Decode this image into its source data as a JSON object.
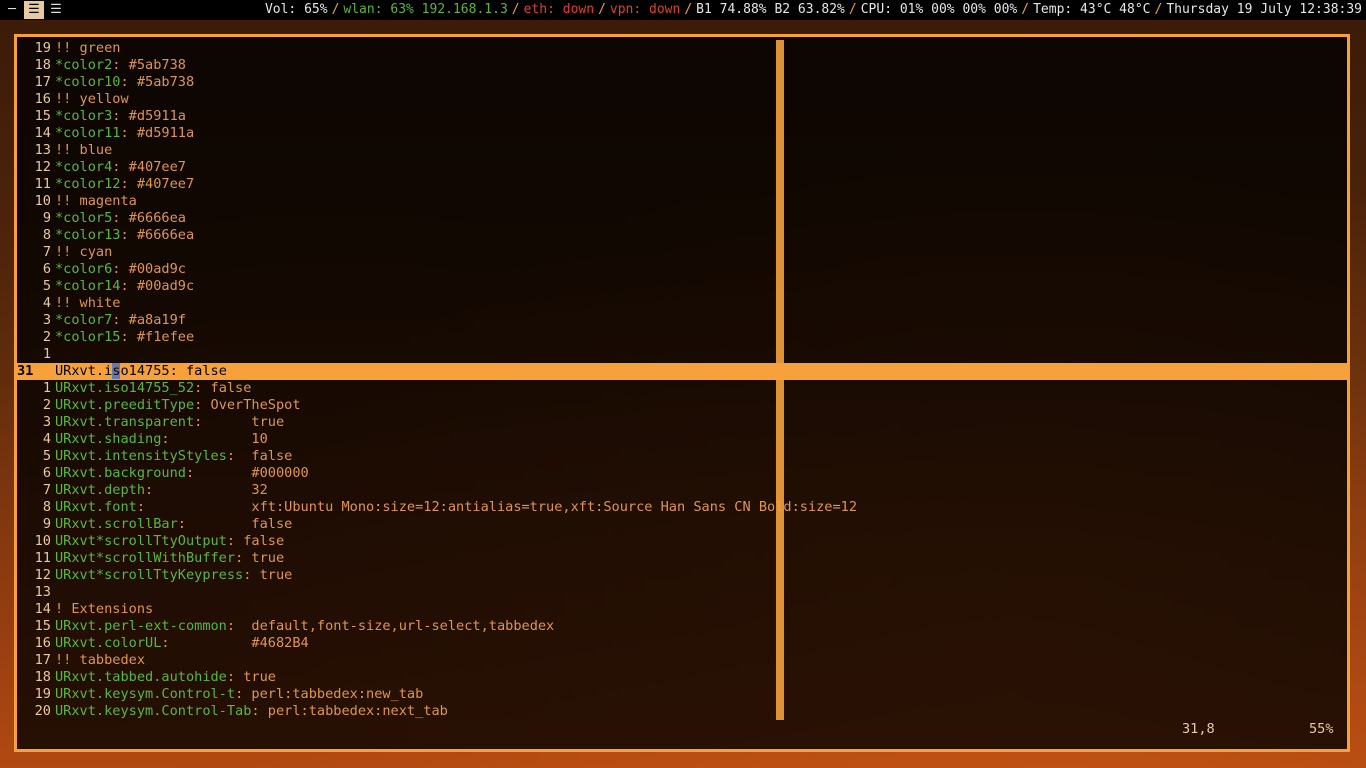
{
  "topbar": {
    "workspace_icons": [
      "minimize-glyph",
      "menu-glyph",
      "menu-glyph"
    ],
    "vol": "Vol: 65%",
    "wlan": "wlan: 63% 192.168.1.3",
    "eth": "eth: down",
    "vpn": "vpn: down",
    "battery": "B1 74.88%  B2 63.82%",
    "cpu": "CPU: 01% 00% 00% 00%",
    "temp": "Temp: 43°C 48°C",
    "datetime": "Thursday 19 July 12:38:39"
  },
  "colors": {
    "accent": "#f6a13c",
    "green": "#5ab738",
    "red": "#e0412a"
  },
  "editor": {
    "lines": [
      {
        "n": "19",
        "key": "",
        "rest": "!! green"
      },
      {
        "n": "18",
        "key": "*color2",
        "rest": ": #5ab738"
      },
      {
        "n": "17",
        "key": "*color10",
        "rest": ": #5ab738"
      },
      {
        "n": "16",
        "key": "",
        "rest": "!! yellow"
      },
      {
        "n": "15",
        "key": "*color3",
        "rest": ": #d5911a"
      },
      {
        "n": "14",
        "key": "*color11",
        "rest": ": #d5911a"
      },
      {
        "n": "13",
        "key": "",
        "rest": "!! blue"
      },
      {
        "n": "12",
        "key": "*color4",
        "rest": ": #407ee7"
      },
      {
        "n": "11",
        "key": "*color12",
        "rest": ": #407ee7"
      },
      {
        "n": "10",
        "key": "",
        "rest": "!! magenta"
      },
      {
        "n": "9",
        "key": "*color5",
        "rest": ": #6666ea"
      },
      {
        "n": "8",
        "key": "*color13",
        "rest": ": #6666ea"
      },
      {
        "n": "7",
        "key": "",
        "rest": "!! cyan"
      },
      {
        "n": "6",
        "key": "*color6",
        "rest": ": #00ad9c"
      },
      {
        "n": "5",
        "key": "*color14",
        "rest": ": #00ad9c"
      },
      {
        "n": "4",
        "key": "",
        "rest": "!! white"
      },
      {
        "n": "3",
        "key": "*color7",
        "rest": ": #a8a19f"
      },
      {
        "n": "2",
        "key": "*color15",
        "rest": ": #f1efee"
      },
      {
        "n": "1",
        "key": "",
        "rest": ""
      },
      {
        "n": "31",
        "key": "",
        "rest": "URxvt.iso14755: false",
        "current": true
      },
      {
        "n": "1",
        "key": "URxvt.iso14755_52",
        "rest": ": false"
      },
      {
        "n": "2",
        "key": "URxvt.preeditType",
        "rest": ": OverTheSpot"
      },
      {
        "n": "3",
        "key": "URxvt.transparent",
        "rest": ":      true"
      },
      {
        "n": "4",
        "key": "URxvt.shading",
        "rest": ":          10"
      },
      {
        "n": "5",
        "key": "URxvt.intensityStyles",
        "rest": ":  false"
      },
      {
        "n": "6",
        "key": "URxvt.background",
        "rest": ":       #000000"
      },
      {
        "n": "7",
        "key": "URxvt.depth",
        "rest": ":            32"
      },
      {
        "n": "8",
        "key": "URxvt.font",
        "rest": ":             xft:Ubuntu Mono:size=12:antialias=true,xft:Source Han Sans CN Bold:size=12"
      },
      {
        "n": "9",
        "key": "URxvt.scrollBar",
        "rest": ":        false"
      },
      {
        "n": "10",
        "key": "URxvt*scrollTtyOutput",
        "rest": ": false"
      },
      {
        "n": "11",
        "key": "URxvt*scrollWithBuffer",
        "rest": ": true"
      },
      {
        "n": "12",
        "key": "URxvt*scrollTtyKeypress",
        "rest": ": true"
      },
      {
        "n": "13",
        "key": "",
        "rest": ""
      },
      {
        "n": "14",
        "key": "",
        "rest": "! Extensions"
      },
      {
        "n": "15",
        "key": "URxvt.perl-ext-common",
        "rest": ":  default,font-size,url-select,tabbedex"
      },
      {
        "n": "16",
        "key": "URxvt.colorUL",
        "rest": ":          #4682B4"
      },
      {
        "n": "17",
        "key": "",
        "rest": "!! tabbedex"
      },
      {
        "n": "18",
        "key": "URxvt.tabbed.autohide",
        "rest": ": true"
      },
      {
        "n": "19",
        "key": "URxvt.keysym.Control-t",
        "rest": ": perl:tabbedex:new_tab"
      },
      {
        "n": "20",
        "key": "URxvt.keysym.Control-Tab",
        "rest": ": perl:tabbedex:next_tab"
      }
    ],
    "cursor_position": "31,8",
    "scroll_percent": "55%"
  }
}
